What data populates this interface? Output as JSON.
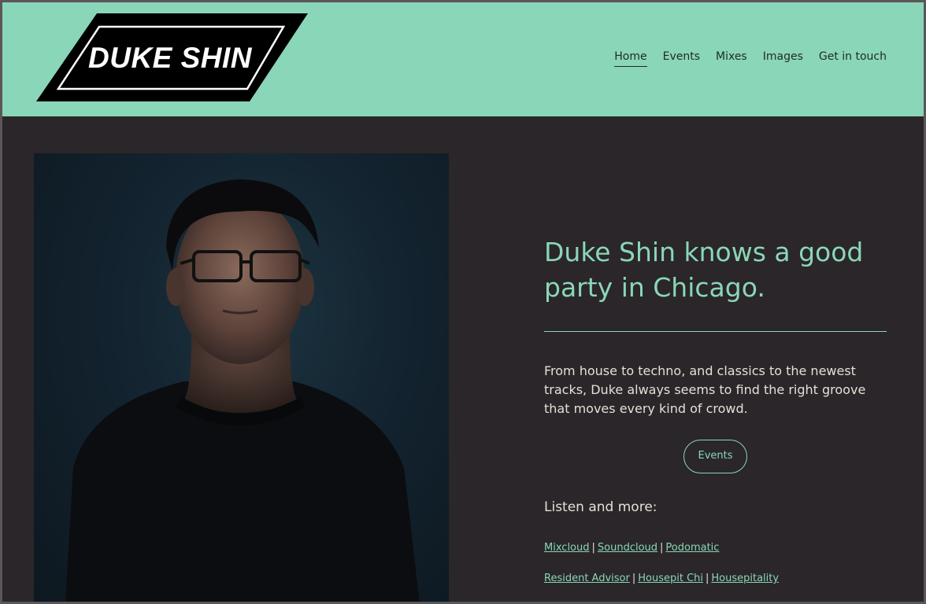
{
  "header": {
    "logo_text": "DUKE SHIN",
    "nav": [
      {
        "label": "Home",
        "active": true
      },
      {
        "label": "Events",
        "active": false
      },
      {
        "label": "Mixes",
        "active": false
      },
      {
        "label": "Images",
        "active": false
      },
      {
        "label": "Get in touch",
        "active": false
      }
    ]
  },
  "hero": {
    "headline": "Duke Shin knows a good party in Chicago.",
    "intro": "From house to techno, and classics to the newest tracks, Duke always seems to find the right groove that moves every kind of crowd.",
    "events_button": "Events",
    "listen_heading": "Listen and more:",
    "link_rows": [
      [
        "Mixcloud",
        "Soundcloud",
        "Podomatic"
      ],
      [
        "Resident Advisor",
        "Housepit Chi",
        "Housepitality"
      ]
    ],
    "link_separator": "|"
  },
  "colors": {
    "header_bg": "#8ad6b8",
    "page_bg": "#2a2629",
    "accent": "#8ad6b8",
    "text": "#e6dfd8",
    "logo_bg": "#000000"
  }
}
